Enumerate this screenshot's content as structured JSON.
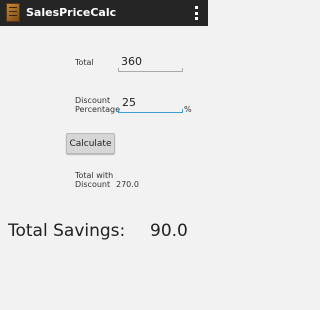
{
  "app": {
    "title": "SalesPriceCalc",
    "icon": "calculator-icon",
    "menu_icon": "overflow-menu-icon"
  },
  "form": {
    "total_label": "Total",
    "total_value": "360",
    "discount_label_line1": "Discount",
    "discount_label_line2": "Percentage",
    "discount_value": "25",
    "percent_suffix": "%",
    "calculate_label": "Calculate",
    "total_with_discount_line1": "Total with",
    "total_with_discount_line2": "Discount",
    "total_with_discount_value": "270.0"
  },
  "summary": {
    "savings_label": "Total Savings:",
    "savings_value": "90.0"
  },
  "colors": {
    "actionbar": "#252525",
    "background": "#f2f2f2",
    "focus_underline": "#3b9fd6"
  }
}
